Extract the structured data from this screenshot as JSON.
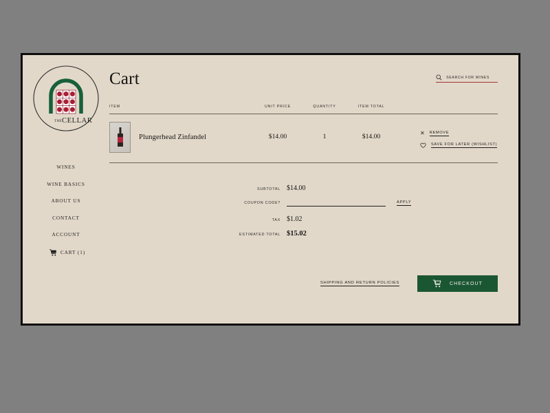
{
  "theme": {
    "page_bg": "#e2d8c9",
    "desktop_bg": "#808080",
    "accent_green": "#1a5632",
    "accent_red": "#9d3535",
    "text": "#141414"
  },
  "brand": {
    "name_prefix": "THE",
    "name": "CELLAR",
    "logo_icon": "wine-cellar-arch-logo"
  },
  "sidebar": {
    "items": [
      {
        "label": "Wines",
        "icon": null
      },
      {
        "label": "Wine Basics",
        "icon": null
      },
      {
        "label": "About Us",
        "icon": null
      },
      {
        "label": "Contact",
        "icon": null
      },
      {
        "label": "Account",
        "icon": null
      },
      {
        "label": "Cart (1)",
        "icon": "shopping-cart-icon"
      }
    ]
  },
  "header": {
    "title": "Cart",
    "search": {
      "icon": "search-icon",
      "placeholder": "Search for Wines",
      "value": ""
    }
  },
  "cart": {
    "columns": [
      "Item",
      "Unit Price",
      "Quantity",
      "Item Total"
    ],
    "rows": [
      {
        "thumbnail": "wine-bottle-thumbnail",
        "name": "Plungerhead Zinfandel",
        "unit_price": "$14.00",
        "quantity": "1",
        "item_total": "$14.00",
        "actions": [
          {
            "label": "Remove",
            "icon": "close-x-icon"
          },
          {
            "label": "Save for Later (Wishlist)",
            "icon": "heart-icon"
          }
        ]
      }
    ]
  },
  "totals": {
    "subtotal_label": "Subtotal",
    "subtotal_value": "$14.00",
    "coupon_label": "Coupon Code?",
    "coupon_value": "",
    "coupon_placeholder": "",
    "apply_label": "Apply",
    "tax_label": "Tax",
    "tax_value": "$1.02",
    "estimated_total_label": "Estimated Total",
    "estimated_total_value": "$15.02"
  },
  "footer": {
    "policy_link": "Shipping and Return Policies",
    "checkout_label": "Checkout",
    "checkout_icon": "shopping-cart-icon"
  }
}
